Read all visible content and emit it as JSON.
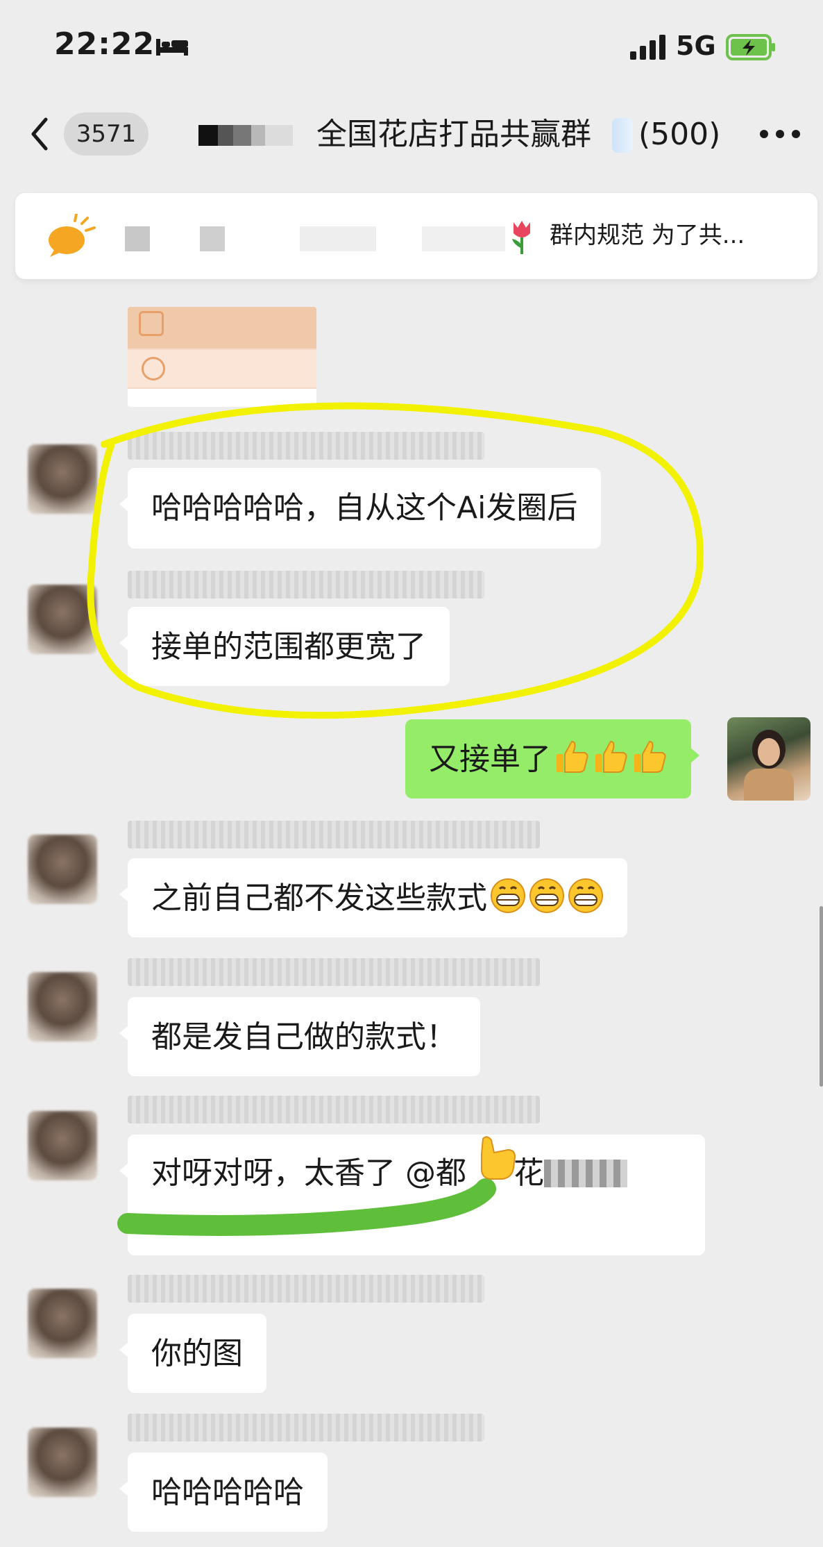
{
  "status_bar": {
    "time": "22:22",
    "network": "5G"
  },
  "nav": {
    "unread_count": "3571",
    "title": "全国花店打品共赢群",
    "member_count": "(500)"
  },
  "announcement": {
    "text": "群内规范 为了共..."
  },
  "messages": [
    {
      "side": "left",
      "text": "哈哈哈哈哈，自从这个Ai发圈后"
    },
    {
      "side": "left",
      "text": "接单的范围都更宽了"
    },
    {
      "side": "right",
      "text": "又接单了",
      "emojis": [
        "thumbs-up",
        "thumbs-up",
        "thumbs-up"
      ]
    },
    {
      "side": "left",
      "text": "之前自己都不发这些款式",
      "emojis": [
        "grin",
        "grin",
        "grin"
      ]
    },
    {
      "side": "left",
      "text": "都是发自己做的款式！"
    },
    {
      "side": "left",
      "text": "对呀对呀，太香了",
      "mention": "@都",
      "mention_tail": "花"
    },
    {
      "side": "left",
      "text": "你的图"
    },
    {
      "side": "left",
      "text": "哈哈哈哈哈"
    }
  ],
  "colors": {
    "chat_background": "#ededed",
    "own_bubble": "#95ec69",
    "highlight_circle": "#f2f200",
    "highlight_stroke": "#5fbe3a"
  }
}
